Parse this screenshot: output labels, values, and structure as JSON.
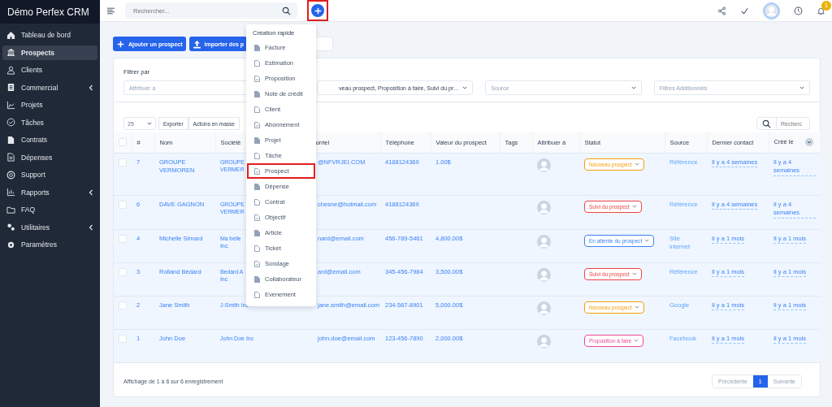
{
  "sidebar": {
    "brand": "Démo Perfex CRM",
    "items": [
      {
        "label": "Tableau de bord",
        "selected": false,
        "expandable": false
      },
      {
        "label": "Prospects",
        "selected": true,
        "expandable": false
      },
      {
        "label": "Clients",
        "selected": false,
        "expandable": false
      },
      {
        "label": "Commercial",
        "selected": false,
        "expandable": true
      },
      {
        "label": "Projets",
        "selected": false,
        "expandable": false
      },
      {
        "label": "Tâches",
        "selected": false,
        "expandable": false
      },
      {
        "label": "Contrats",
        "selected": false,
        "expandable": false
      },
      {
        "label": "Dépenses",
        "selected": false,
        "expandable": false
      },
      {
        "label": "Support",
        "selected": false,
        "expandable": false
      },
      {
        "label": "Rapports",
        "selected": false,
        "expandable": true
      },
      {
        "label": "FAQ",
        "selected": false,
        "expandable": false
      },
      {
        "label": "Utilitaires",
        "selected": false,
        "expandable": true
      },
      {
        "label": "Paramètres",
        "selected": false,
        "expandable": false
      }
    ]
  },
  "topbar": {
    "search_placeholder": "Rechercher...",
    "add_highlighted": true,
    "notification_count": "1"
  },
  "actions": [
    "Ajouter un prospect",
    "Importer des p"
  ],
  "filters": {
    "title": "Filtrer par",
    "fields": [
      {
        "placeholder": "Attribuer à"
      },
      {
        "value": "veau prospect, Proposition à faire, Suivi du pr…"
      },
      {
        "placeholder": "Source"
      },
      {
        "placeholder": "Filtres Additionnels"
      }
    ]
  },
  "table_tools": {
    "page_size": "25",
    "buttons": [
      "Exporter",
      "Actions en masse"
    ],
    "search_placeholder": "Recherc"
  },
  "table": {
    "all_checked": false,
    "columns": [
      "#",
      "Nom",
      "Société",
      "urriel",
      "Téléphone",
      "Valeur du prospect",
      "Tags",
      "Attribuer à",
      "Statut",
      "Source",
      "Dernier contact",
      "Créé le"
    ],
    "rows": [
      {
        "checked": false,
        "id": "7",
        "name": "GROUPE VERMOREN",
        "company": "GROUPE VERMER",
        "email": "@NFVRJEI.COM",
        "phone": "4188124369",
        "value": "1.00$",
        "status": {
          "label": "Nouveau prospect",
          "color": "#f59e0b"
        },
        "source": "Référence",
        "last_contact": "Il y a 4 semaines",
        "created": "Il y a 4 semaines"
      },
      {
        "checked": false,
        "id": "6",
        "name": "DAVE GAGNON",
        "company": "GROUPE VERMER",
        "email": "chesne@hotmail.com",
        "phone": "4188124369",
        "status": {
          "label": "Suivi du prospect",
          "color": "#ef4444"
        },
        "source": "Référence",
        "last_contact": "Il y a 4 semaines",
        "created": "Il y a 4 semaines"
      },
      {
        "checked": false,
        "id": "4",
        "name": "Michelle Simard",
        "company": "Ma belle Inc.",
        "email": "nard@email.com",
        "phone": "456-789-5461",
        "value": "4,800.00$",
        "status": {
          "label": "En attente du prospect",
          "color": "#3b82f6"
        },
        "source": "Site internet",
        "last_contact": "Il y a 1 mois",
        "created": "Il y a 1 mois"
      },
      {
        "checked": false,
        "id": "3",
        "name": "Rolland Bédard",
        "company": "Bedard A Inc",
        "email": "ard@email.com",
        "phone": "345-456-7984",
        "value": "3,500.00$",
        "status": {
          "label": "Suivi du prospect",
          "color": "#ef4444"
        },
        "source": "Référence",
        "last_contact": "Il y a 1 mois",
        "created": "Il y a 1 mois"
      },
      {
        "checked": false,
        "id": "2",
        "name": "Jane Smith",
        "company": "J-Smith Inc",
        "email": "jane.smith@email.com",
        "phone": "234-567-8901",
        "value": "5,000.00$",
        "status": {
          "label": "Nouveau prospect",
          "color": "#f59e0b"
        },
        "source": "Google",
        "last_contact": "Il y a 1 mois",
        "created": "Il y a 1 mois"
      },
      {
        "checked": false,
        "id": "1",
        "name": "John Doe",
        "company": "John Doe Inc",
        "email": "john.doe@email.com",
        "phone": "123-456-7890",
        "value": "2,000.00$",
        "status": {
          "label": "Proposition à faire",
          "color": "#ec4899"
        },
        "source": "Facebook",
        "last_contact": "Il y a 1 mois",
        "created": "Il y a 1 mois"
      }
    ]
  },
  "footer": {
    "info": "Affichage de 1 à 6 sur 6 enregistrement",
    "pages": [
      {
        "label": "Précédente",
        "selected": false
      },
      {
        "label": "1",
        "selected": true
      },
      {
        "label": "Suivante",
        "selected": false
      }
    ]
  },
  "quick_create": {
    "title": "Création rapide",
    "items": [
      {
        "label": "Facture",
        "highlighted": false
      },
      {
        "label": "Estimation",
        "highlighted": false
      },
      {
        "label": "Proposition",
        "highlighted": false
      },
      {
        "label": "Note de crédit",
        "highlighted": false
      },
      {
        "label": "Client",
        "highlighted": false
      },
      {
        "label": "Abonnement",
        "highlighted": false
      },
      {
        "label": "Projet",
        "highlighted": false
      },
      {
        "label": "Tâche",
        "highlighted": false
      },
      {
        "label": "Prospect",
        "highlighted": true
      },
      {
        "label": "Dépense",
        "highlighted": false
      },
      {
        "label": "Contrat",
        "highlighted": false
      },
      {
        "label": "Objectif",
        "highlighted": false
      },
      {
        "label": "Article",
        "highlighted": false
      },
      {
        "label": "Ticket",
        "highlighted": false
      },
      {
        "label": "Sondage",
        "highlighted": false
      },
      {
        "label": "Collaborateur",
        "highlighted": false
      },
      {
        "label": "Evenement",
        "highlighted": false
      }
    ]
  }
}
